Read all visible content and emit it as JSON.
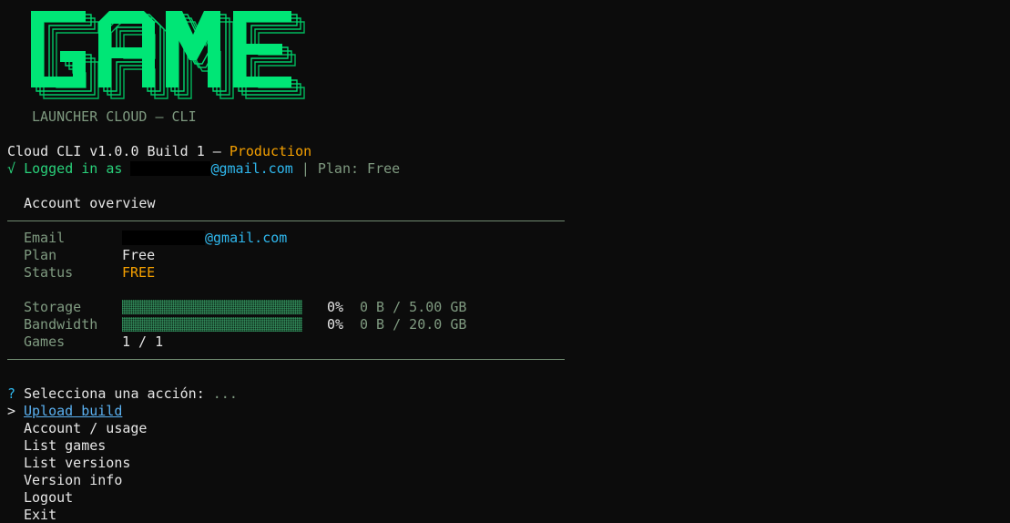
{
  "logo": {
    "text": "GAME",
    "subtitle": "LAUNCHER CLOUD — CLI",
    "color": "#00e676"
  },
  "header": {
    "version_line": "Cloud CLI v1.0.0 Build 1 — ",
    "env": "Production",
    "check": "√",
    "logged_prefix": "Logged in as",
    "email_domain": "@gmail.com",
    "plan_sep": "| Plan: Free"
  },
  "account": {
    "title": "Account overview",
    "rows": {
      "email_label": "Email",
      "email_domain": "@gmail.com",
      "plan_label": "Plan",
      "plan_value": "Free",
      "status_label": "Status",
      "status_value": "FREE"
    },
    "storage": {
      "label": "Storage",
      "percent": "0%",
      "amount": "0 B / 5.00 GB",
      "fraction": 0
    },
    "bandwidth": {
      "label": "Bandwidth",
      "percent": "0%",
      "amount": "0 B / 20.0 GB",
      "fraction": 0
    },
    "games": {
      "label": "Games",
      "value": "1 / 1"
    }
  },
  "prompt": {
    "qmark": "?",
    "question": "Selecciona una acción:",
    "hint": "...",
    "pointer": ">",
    "options": [
      "Upload build",
      "Account / usage",
      "List games",
      "List versions",
      "Version info",
      "Logout",
      "Exit"
    ]
  }
}
